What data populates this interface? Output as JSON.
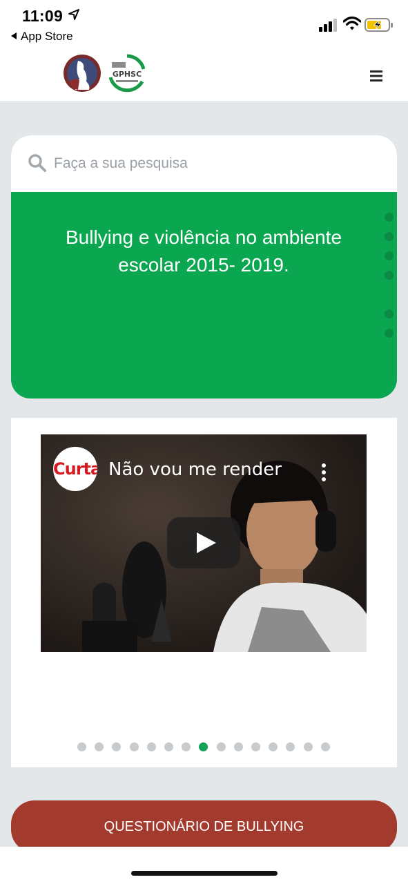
{
  "status_bar": {
    "time": "11:09",
    "back_app": "App Store"
  },
  "header": {
    "logo1_icon": "institution-logo-icon",
    "logo2_icon": "gphsc-logo-icon",
    "logo2_text": "GPHSC",
    "menu_icon": "hamburger-menu-icon"
  },
  "search": {
    "placeholder": "Faça a sua pesquisa",
    "value": ""
  },
  "slide": {
    "text_line1": "Bullying e violência no ambiente",
    "text_line2": "escolar 2015- 2019.",
    "background": "#0aa650",
    "indicator_count": 6
  },
  "video": {
    "channel_logo_text": "Curta",
    "title": "Não vou me render",
    "play_icon": "play-icon",
    "options_icon": "more-vert-icon"
  },
  "carousel": {
    "dot_count": 15,
    "active_index": 7,
    "active_color": "#13a358"
  },
  "questionnaire": {
    "label": "QUESTIONÁRIO DE BULLYING",
    "color": "#a33a2e"
  }
}
